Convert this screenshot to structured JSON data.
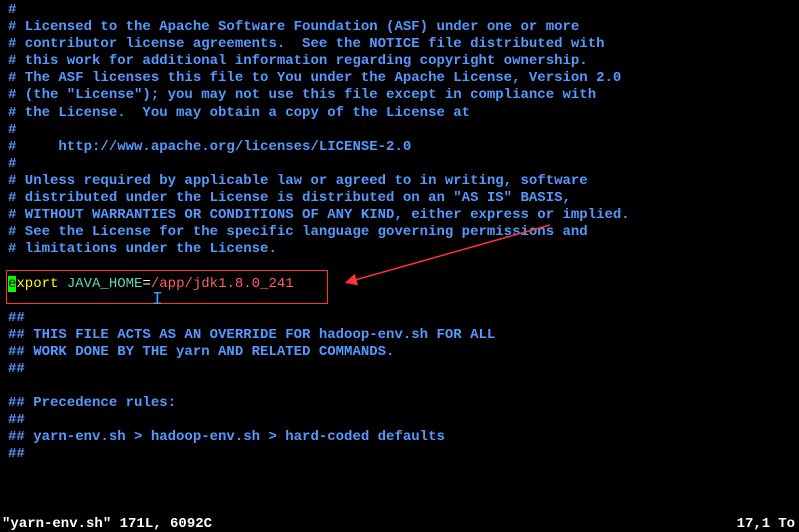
{
  "lines": {
    "l0": "#",
    "l1": "# Licensed to the Apache Software Foundation (ASF) under one or more",
    "l2": "# contributor license agreements.  See the NOTICE file distributed with",
    "l3": "# this work for additional information regarding copyright ownership.",
    "l4": "# The ASF licenses this file to You under the Apache License, Version 2.0",
    "l5": "# (the \"License\"); you may not use this file except in compliance with",
    "l6": "# the License.  You may obtain a copy of the License at",
    "l7": "#",
    "l8": "#     http://www.apache.org/licenses/LICENSE-2.0",
    "l9": "#",
    "l10": "# Unless required by applicable law or agreed to in writing, software",
    "l11": "# distributed under the License is distributed on an \"AS IS\" BASIS,",
    "l12": "# WITHOUT WARRANTIES OR CONDITIONS OF ANY KIND, either express or implied.",
    "l13": "# See the License for the specific language governing permissions and",
    "l14": "# limitations under the License.",
    "l15": "",
    "l17": "",
    "l18": "##",
    "l19": "## THIS FILE ACTS AS AN OVERRIDE FOR hadoop-env.sh FOR ALL",
    "l20": "## WORK DONE BY THE yarn AND RELATED COMMANDS.",
    "l21": "##",
    "l22": "",
    "l23": "## Precedence rules:",
    "l24": "##",
    "l25": "## yarn-env.sh > hadoop-env.sh > hard-coded defaults",
    "l26": "##"
  },
  "export_line": {
    "first_char": "e",
    "rest_kw": "xport ",
    "var": "JAVA_HOME",
    "equals": "=",
    "path": "/app/jdk1.8.0_241"
  },
  "status": {
    "file": "\"yarn-env.sh\" 171L, 6092C",
    "position": "17,1",
    "right": "To"
  }
}
